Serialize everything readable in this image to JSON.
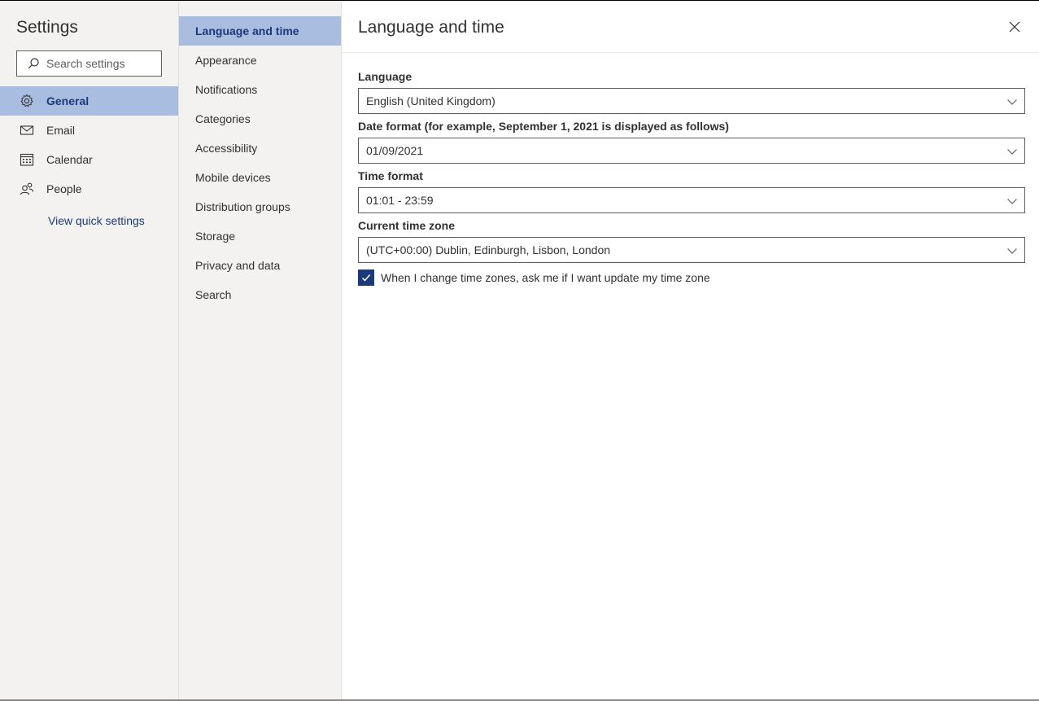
{
  "left_nav": {
    "title": "Settings",
    "search_placeholder": "Search settings",
    "items": [
      {
        "label": "General",
        "icon": "gear-icon",
        "active": true
      },
      {
        "label": "Email",
        "icon": "mail-icon",
        "active": false
      },
      {
        "label": "Calendar",
        "icon": "calendar-icon",
        "active": false
      },
      {
        "label": "People",
        "icon": "people-icon",
        "active": false
      }
    ],
    "quick_settings_link": "View quick settings"
  },
  "sub_nav": {
    "items": [
      {
        "label": "Language and time",
        "active": true
      },
      {
        "label": "Appearance",
        "active": false
      },
      {
        "label": "Notifications",
        "active": false
      },
      {
        "label": "Categories",
        "active": false
      },
      {
        "label": "Accessibility",
        "active": false
      },
      {
        "label": "Mobile devices",
        "active": false
      },
      {
        "label": "Distribution groups",
        "active": false
      },
      {
        "label": "Storage",
        "active": false
      },
      {
        "label": "Privacy and data",
        "active": false
      },
      {
        "label": "Search",
        "active": false
      }
    ]
  },
  "main": {
    "title": "Language and time",
    "fields": [
      {
        "label": "Language",
        "value": "English (United Kingdom)"
      },
      {
        "label": "Date format (for example, September 1, 2021 is displayed as follows)",
        "value": "01/09/2021"
      },
      {
        "label": "Time format",
        "value": "01:01 - 23:59"
      },
      {
        "label": "Current time zone",
        "value": "(UTC+00:00) Dublin, Edinburgh, Lisbon, London"
      }
    ],
    "timezone_prompt": {
      "label": "When I change time zones, ask me if I want update my time zone",
      "checked": true
    }
  },
  "colors": {
    "accent": "#1b3a7a",
    "selected_bg": "#a9bde0",
    "nav_bg": "#f3f2f1"
  }
}
